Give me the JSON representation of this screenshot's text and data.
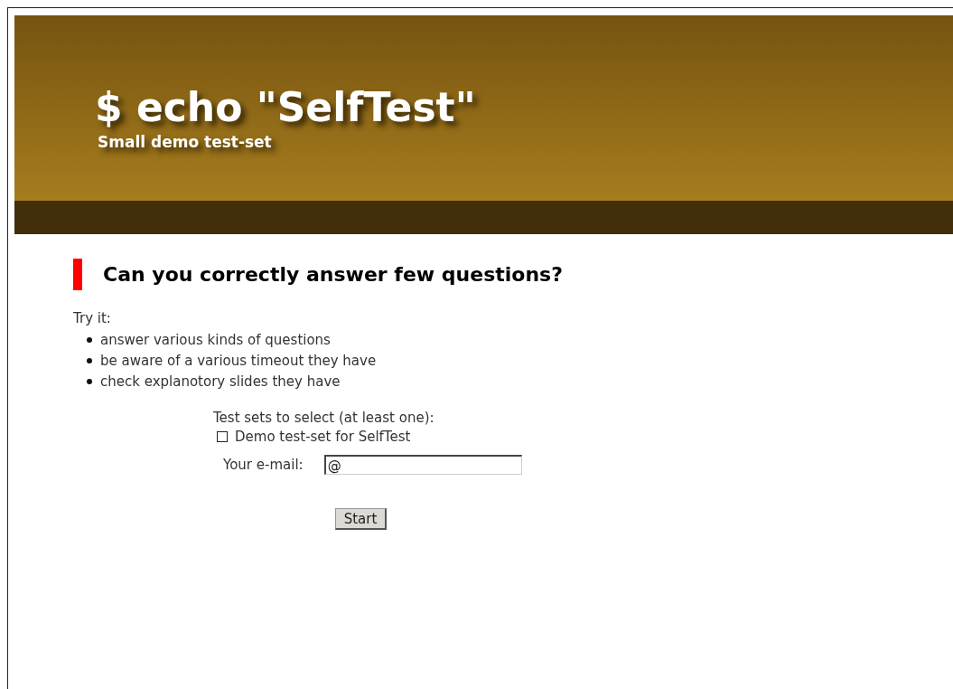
{
  "header": {
    "title": "$ echo \"SelfTest\"",
    "subtitle": "Small demo test-set"
  },
  "heading": "Can you correctly answer few questions?",
  "intro": "Try it:",
  "bullets": [
    "answer various kinds of questions",
    "be aware of a various timeout they have",
    "check explanotory slides they have"
  ],
  "form": {
    "label": "Test sets to select (at least one):",
    "test_sets": [
      {
        "label": "Demo test-set for SelfTest",
        "checked": false
      }
    ],
    "email": {
      "label": "Your e-mail:",
      "value": "@"
    },
    "submit": "Start"
  }
}
